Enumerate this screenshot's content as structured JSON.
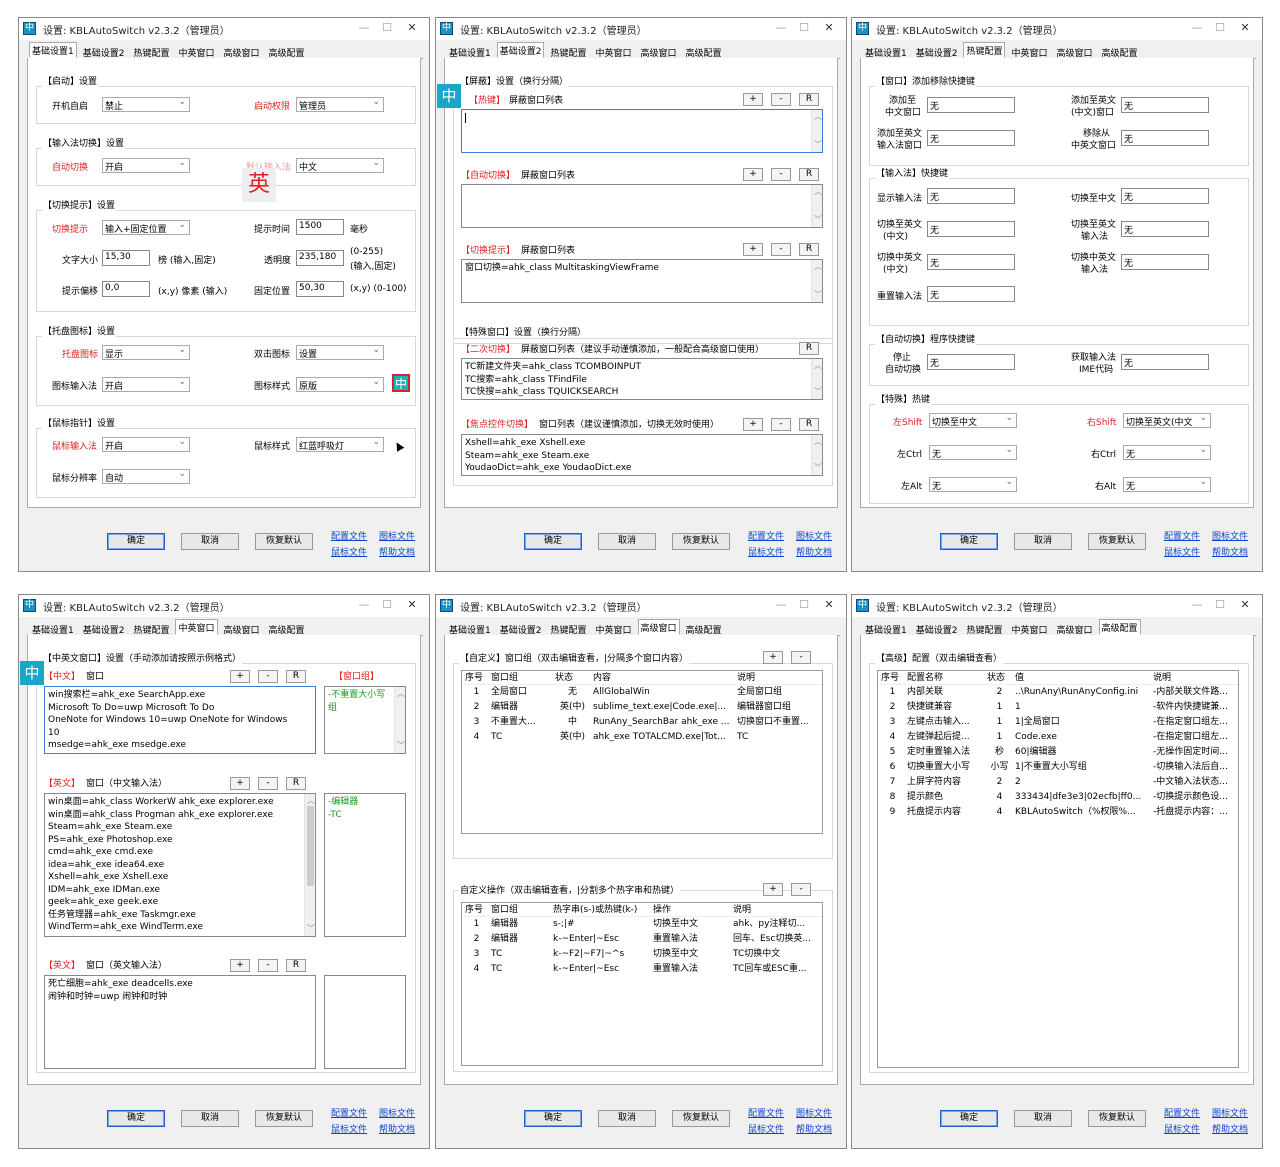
{
  "window_title": "设置: KBLAutoSwitch v2.3.2（管理员）",
  "app_icon_glyph": "中",
  "window_controls": {
    "minimize": "—",
    "maximize": "☐",
    "close": "✕"
  },
  "tabs": [
    "基础设置1",
    "基础设置2",
    "热键配置",
    "中英窗口",
    "高级窗口",
    "高级配置"
  ],
  "footer": {
    "ok": "确定",
    "cancel": "取消",
    "restore": "恢复默认",
    "config_file": "配置文件",
    "icon_file": "图标文件",
    "mouse_file": "鼠标文件",
    "help_doc": "帮助文档"
  },
  "small_buttons": {
    "plus": "+",
    "minus": "-",
    "reload": "R"
  },
  "indicators": {
    "zh": "中",
    "en": "英"
  },
  "colors": {
    "accent_red": "#e02020",
    "accent_green": "#1a9a1a",
    "link_blue": "#0b46c8",
    "indicator_cyan": "#1ba6c8"
  },
  "p1": {
    "g_start": "【启动】设置",
    "autostart_label": "开机自启",
    "autostart_value": "禁止",
    "perm_label": "启动权限",
    "perm_value": "管理员",
    "g_ime": "【输入法切换】设置",
    "autoswitch_label": "自动切换",
    "autoswitch_value": "开启",
    "default_ime_label": "默认输入法",
    "default_ime_value": "中文",
    "g_tip": "【切换提示】设置",
    "tip_label": "切换提示",
    "tip_value": "输入+固定位置",
    "tiptime_label": "提示时间",
    "tiptime_value": "1500",
    "tiptime_unit": "毫秒",
    "fontsize_label": "文字大小",
    "fontsize_value": "15,30",
    "fontsize_note": "榜 (输入,固定)",
    "opacity_label": "透明度",
    "opacity_value": "235,180",
    "opacity_note1": "(0-255)",
    "opacity_note2": "(输入,固定)",
    "offset_label": "提示偏移",
    "offset_value": "0,0",
    "offset_note": "(x,y) 像素 (输入)",
    "fixpos_label": "固定位置",
    "fixpos_value": "50,30",
    "fixpos_note": "(x,y) (0-100)",
    "g_tray": "【托盘图标】设置",
    "trayicon_label": "托盘图标",
    "trayicon_value": "显示",
    "dblclick_label": "双击图标",
    "dblclick_value": "设置",
    "iconime_label": "图标输入法",
    "iconime_value": "开启",
    "iconstyle_label": "图标样式",
    "iconstyle_value": "原版",
    "g_mouse": "【鼠标指针】设置",
    "mouseime_label": "鼠标输入法",
    "mouseime_value": "开启",
    "mousestyle_label": "鼠标样式",
    "mousestyle_value": "红蓝呼吸灯",
    "mouseres_label": "鼠标分辨率",
    "mouseres_value": "自动"
  },
  "p2": {
    "g_block": "【屏蔽】设置（换行分隔）",
    "hotkey_tag": "【热键】",
    "hotkey_label": "屏蔽窗口列表",
    "auto_tag": "【自动切换】",
    "auto_label": "屏蔽窗口列表",
    "tip_tag": "【切换提示】",
    "tip_label": "屏蔽窗口列表",
    "tip_list": [
      "窗口切换=ahk_class MultitaskingViewFrame"
    ],
    "g_special": "【特殊窗口】设置（换行分隔）",
    "second_tag": "【二次切换】",
    "second_label": "屏蔽窗口列表（建议手动谨慎添加，一般配合高级窗口使用）",
    "second_list": [
      "TC新建文件夹=ahk_class TCOMBOINPUT",
      "TC搜索=ahk_class TFindFile",
      "TC快搜=ahk_class TQUICKSEARCH"
    ],
    "focus_tag": "【焦点控件切换】",
    "focus_label": "窗口列表（建议谨慎添加，切换无效时使用）",
    "focus_list": [
      "Xshell=ahk_exe Xshell.exe",
      "Steam=ahk_exe Steam.exe",
      "YoudaoDict=ahk_exe YoudaoDict.exe"
    ]
  },
  "p3": {
    "g_win": "【窗口】添加移除快捷键",
    "add_zh_l1": "添加至",
    "add_zh_l2": "中文窗口",
    "add_zh_value": "无",
    "add_en_l1": "添加至英文",
    "add_en_l2": "(中文)窗口",
    "add_en_value": "无",
    "add_enime_l1": "添加至英文",
    "add_enime_l2": "输入法窗口",
    "add_enime_value": "无",
    "remove_l1": "移除从",
    "remove_l2": "中英文窗口",
    "remove_value": "无",
    "g_ime": "【输入法】快捷键",
    "show_ime_label": "显示输入法",
    "show_ime_value": "无",
    "to_zh_label": "切换至中文",
    "to_zh_value": "无",
    "to_en_zh_l1": "切换至英文",
    "to_en_zh_l2": "(中文)",
    "to_en_zh_value": "无",
    "to_en_ime_l1": "切换至英文",
    "to_en_ime_l2": "输入法",
    "to_en_ime_value": "无",
    "zhen_zh_l1": "切换中英文",
    "zhen_zh_l2": "(中文)",
    "zhen_zh_value": "无",
    "zhen_ime_l1": "切换中英文",
    "zhen_ime_l2": "输入法",
    "zhen_ime_value": "无",
    "reset_label": "重置输入法",
    "reset_value": "无",
    "g_auto": "【自动切换】程序快捷键",
    "stop_l1": "停止",
    "stop_l2": "自动切换",
    "stop_value": "无",
    "getime_l1": "获取输入法",
    "getime_l2": "IME代码",
    "getime_value": "无",
    "g_special": "【特殊】热键",
    "lshift_label": "左Shift",
    "lshift_value": "切换至中文",
    "rshift_label": "右Shift",
    "rshift_value": "切换至英文(中文",
    "lctrl_label": "左Ctrl",
    "lctrl_value": "无",
    "rctrl_label": "右Ctrl",
    "rctrl_value": "无",
    "lalt_label": "左Alt",
    "lalt_value": "无",
    "ralt_label": "右Alt",
    "ralt_value": "无"
  },
  "p4": {
    "g_title": "【中英文窗口】设置（手动添加请按照示例格式）",
    "zh_tag": "【中文】",
    "zh_label": "窗口",
    "group_tag": "【窗口组】",
    "zh_list": [
      "win搜索栏=ahk_exe SearchApp.exe",
      "Microsoft To Do=uwp Microsoft To Do",
      "OneNote for Windows 10=uwp  OneNote for Windows",
      "10",
      "msedge=ahk_exe msedge.exe"
    ],
    "zh_side": [
      "-不重置大小写",
      "组"
    ],
    "enzh_tag": "【英文】",
    "enzh_label": "窗口（中文输入法）",
    "enzh_list": [
      "win桌面=ahk_class WorkerW ahk_exe explorer.exe",
      "win桌面=ahk_class Progman ahk_exe explorer.exe",
      "Steam=ahk_exe Steam.exe",
      "PS=ahk_exe Photoshop.exe",
      "cmd=ahk_exe cmd.exe",
      "idea=ahk_exe idea64.exe",
      "Xshell=ahk_exe Xshell.exe",
      "IDM=ahk_exe IDMan.exe",
      "geek=ahk_exe geek.exe",
      "任务管理器=ahk_exe Taskmgr.exe",
      "WindTerm=ahk_exe WindTerm.exe"
    ],
    "enzh_side": [
      "-编辑器",
      "-TC"
    ],
    "enen_tag": "【英文】",
    "enen_label": "窗口（英文输入法）",
    "enen_list": [
      "死亡细胞=ahk_exe deadcells.exe",
      "闹钟和时钟=uwp 闹钟和时钟"
    ]
  },
  "p5": {
    "g_custom": "【自定义】窗口组（双击编辑查看，|分隔多个窗口内容）",
    "cols1": [
      "序号",
      "窗口组",
      "状态",
      "内容",
      "说明"
    ],
    "rows1": [
      [
        "1",
        "全局窗口",
        "无",
        "AllGlobalWin",
        "全局窗口组"
      ],
      [
        "2",
        "编辑器",
        "英(中)",
        "sublime_text.exe|Code.exe|...",
        "编辑器窗口组"
      ],
      [
        "3",
        "不重置大...",
        "中",
        "RunAny_SearchBar ahk_exe ...",
        "切换窗口不重置..."
      ],
      [
        "4",
        "TC",
        "英(中)",
        "ahk_exe TOTALCMD.exe|Tot...",
        "TC"
      ]
    ],
    "g_ops": "自定义操作（双击编辑查看，|分割多个热字串和热键）",
    "cols2": [
      "序号",
      "窗口组",
      "热字串(s-)或热键(k-)",
      "操作",
      "说明"
    ],
    "rows2": [
      [
        "1",
        "编辑器",
        "s-;|#",
        "切换至中文",
        "ahk、py注释切..."
      ],
      [
        "2",
        "编辑器",
        "k-~Enter|~Esc",
        "重置输入法",
        "回车、Esc切换英..."
      ],
      [
        "3",
        "TC",
        "k-~F2|~F7|~^s",
        "切换至中文",
        "TC切换中文"
      ],
      [
        "4",
        "TC",
        "k-~Enter|~Esc",
        "重置输入法",
        "TC回车或ESC重..."
      ]
    ]
  },
  "p6": {
    "g_adv": "【高级】配置（双击编辑查看）",
    "cols": [
      "序号",
      "配置名称",
      "状态",
      "值",
      "说明"
    ],
    "rows": [
      [
        "1",
        "内部关联",
        "2",
        "..\\RunAny\\RunAnyConfig.ini",
        "-内部关联文件路..."
      ],
      [
        "2",
        "快捷键兼容",
        "1",
        "1",
        "-软件内快捷键兼..."
      ],
      [
        "3",
        "左键点击输入...",
        "1",
        "1|全局窗口",
        "-在指定窗口组左..."
      ],
      [
        "4",
        "左键弹起后提...",
        "1",
        "Code.exe",
        "-在指定窗口组左..."
      ],
      [
        "5",
        "定时重置输入法",
        "秒",
        "60|编辑器",
        "-无操作固定时间..."
      ],
      [
        "6",
        "切换重置大小写",
        "小写",
        "1|不重置大小写组",
        "-切换输入法后自..."
      ],
      [
        "7",
        "上屏字符内容",
        "2",
        "2",
        "-中文输入法状态..."
      ],
      [
        "8",
        "提示颜色",
        "4",
        "333434|dfe3e3|02ecfb|ff0...",
        "-切换提示颜色设..."
      ],
      [
        "9",
        "托盘提示内容",
        "4",
        "KBLAutoSwitch（%权限%...",
        "-托盘提示内容：..."
      ]
    ]
  }
}
